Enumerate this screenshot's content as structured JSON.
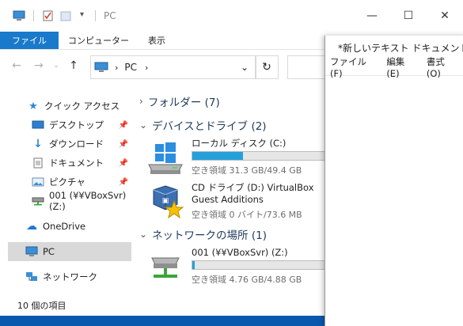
{
  "explorer": {
    "title": "PC",
    "ribbon_tabs": [
      "ファイル",
      "コンピューター",
      "表示"
    ],
    "address_location": "PC",
    "nav_items": [
      {
        "label": "クイック アクセス",
        "icon": "star-icon"
      },
      {
        "label": "デスクトップ",
        "icon": "desktop-icon",
        "pinned": true
      },
      {
        "label": "ダウンロード",
        "icon": "download-icon",
        "pinned": true
      },
      {
        "label": "ドキュメント",
        "icon": "document-icon",
        "pinned": true
      },
      {
        "label": "ピクチャ",
        "icon": "pictures-icon",
        "pinned": true
      },
      {
        "label": "001 (¥¥VBoxSvr) (Z:)",
        "icon": "network-drive-icon"
      },
      {
        "label": "OneDrive",
        "icon": "cloud-icon"
      },
      {
        "label": "PC",
        "icon": "pc-icon",
        "selected": true
      },
      {
        "label": "ネットワーク",
        "icon": "network-icon"
      }
    ],
    "groups": {
      "folders": "フォルダー (7)",
      "devices": "デバイスとドライブ (2)",
      "network": "ネットワークの場所 (1)"
    },
    "drives": [
      {
        "name": "ローカル ディスク (C:)",
        "free": "空き領域 31.3 GB/49.4 GB",
        "used_fraction": 0.37,
        "icon": "windows-drive-icon"
      },
      {
        "name": "CD ドライブ (D:) VirtualBox Guest Additions",
        "free": "空き領域 0 バイト/73.6 MB",
        "icon": "virtualbox-cd-icon"
      },
      {
        "name": "001 (¥¥VBoxSvr) (Z:)",
        "free": "空き領域 4.76 GB/4.88 GB",
        "used_fraction": 0.02,
        "icon": "network-share-icon"
      }
    ],
    "status": "10 個の項目"
  },
  "notepad": {
    "title": "*新しいテキスト ドキュメント - メモ帳",
    "menus": [
      "ファイル(F)",
      "編集(E)",
      "書式(O)"
    ]
  },
  "colors": {
    "accent": "#1979ca",
    "bar_fill": "#26a0da",
    "desktop": "#0a64c8"
  }
}
